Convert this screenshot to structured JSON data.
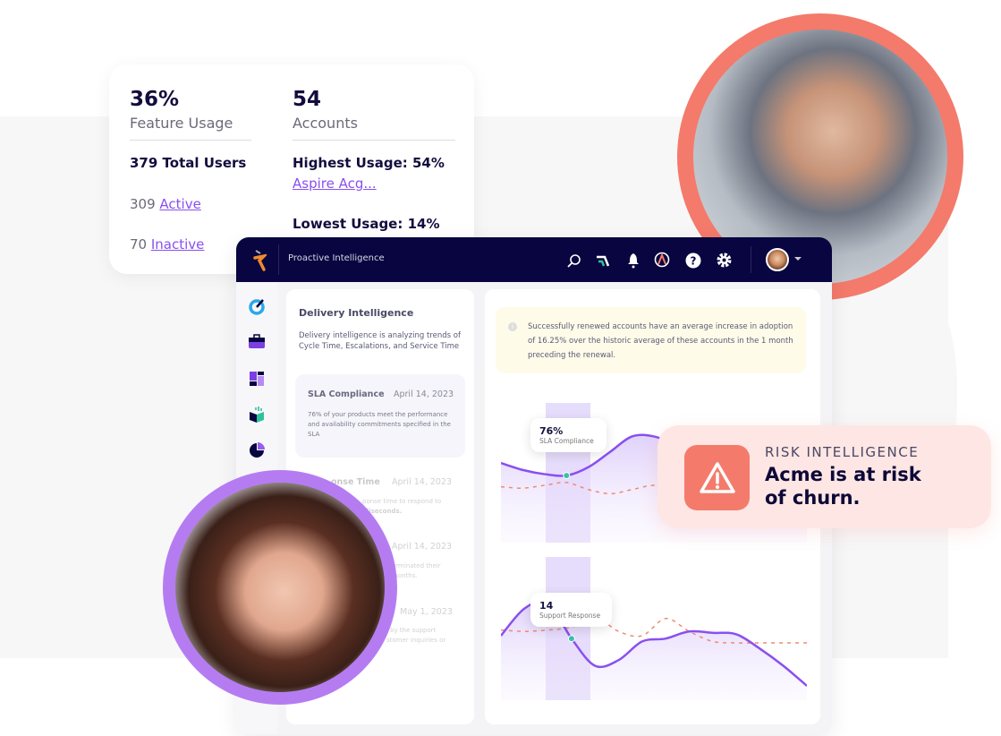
{
  "stats_card": {
    "feature_usage_value": "36%",
    "feature_usage_label": "Feature Usage",
    "total_users": "379 Total Users",
    "active_count": "309",
    "active_label": "Active",
    "inactive_count": "70",
    "inactive_label": "Inactive",
    "accounts_value": "54",
    "accounts_label": "Accounts",
    "highest_usage": "Highest Usage: 54%",
    "highest_account": "Aspire Acg...",
    "lowest_usage": "Lowest Usage: 14%"
  },
  "header": {
    "title": "Proactive Intelligence",
    "icons": [
      "search-icon",
      "signal-icon",
      "bell-icon",
      "gauge-icon",
      "help-icon",
      "gear-icon",
      "avatar",
      "caret-down-icon"
    ]
  },
  "sidebar": {
    "icons": [
      "target-icon",
      "toolbox-icon",
      "layout-icon",
      "chart-box-icon",
      "pie-chart-icon"
    ]
  },
  "left_panel": {
    "title": "Delivery Intelligence",
    "description": "Delivery intelligence is analyzing trends of Cycle Time, Escalations, and Service Time",
    "cards": [
      {
        "title": "SLA Compliance",
        "date": "April 14, 2023",
        "text": "76% of your products meet the performance and availability commitments specified in the SLA"
      },
      {
        "title": "onse Time",
        "date": "April 14, 2023",
        "line1": "ponse time to respond to",
        "line2": "illiseconds."
      },
      {
        "date": "April 14, 2023",
        "line1": "erminated their",
        "line2": "months."
      },
      {
        "date": "May 1, 2023",
        "line1": "by the support",
        "line2": "stomer inquiries or"
      }
    ]
  },
  "right_panel": {
    "info_text": "Successfully renewed accounts have an average increase in adoption of 16.25% over the historic average of these accounts in the 1 month preceding the renewal.",
    "tooltip1": {
      "value": "76%",
      "label": "SLA Compliance"
    },
    "tooltip2": {
      "value": "14",
      "label": "Support Response"
    }
  },
  "risk_card": {
    "label": "RISK INTELLIGENCE",
    "message_line1": "Acme is at risk",
    "message_line2": "of churn."
  },
  "colors": {
    "navy": "#080540",
    "purple": "#8a4ff0",
    "coral": "#f47a6b",
    "teal": "#3cc0a8",
    "risk_bg": "#fde6e3"
  },
  "chart_data": [
    {
      "type": "area",
      "series": [
        {
          "values": [
            57,
            52,
            49,
            48,
            54,
            65,
            76,
            76,
            70,
            64,
            62,
            62,
            60,
            61,
            63
          ]
        },
        {
          "values": [
            40,
            39,
            41,
            43,
            38,
            35,
            38,
            41,
            39,
            42,
            43,
            40,
            41,
            40,
            41
          ],
          "style": "dashed"
        }
      ],
      "highlight_index": 3
    },
    {
      "type": "area",
      "series": [
        {
          "values": [
            45,
            64,
            68,
            43,
            24,
            28,
            41,
            43,
            48,
            47,
            46,
            36,
            24,
            10
          ]
        },
        {
          "values": [
            49,
            48,
            49,
            51,
            58,
            48,
            45,
            57,
            48,
            41,
            40,
            40,
            40,
            40
          ],
          "style": "dashed"
        }
      ],
      "highlight_index": 3
    }
  ]
}
